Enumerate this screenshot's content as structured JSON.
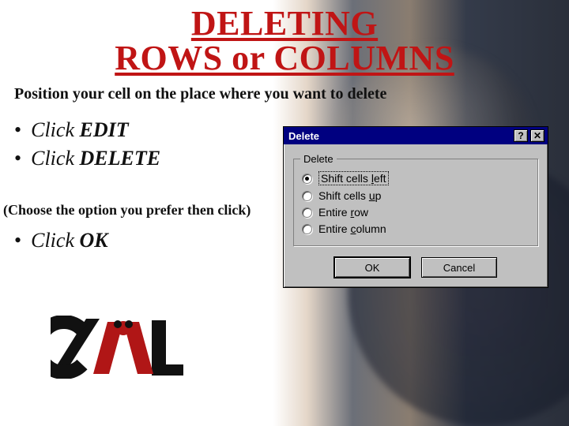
{
  "title_line1": "DELETING",
  "title_line2": "ROWS or COLUMNS",
  "subtitle": "Position your cell on the place where you want to delete",
  "bullet_prefix": "Click",
  "bullets": {
    "edit": "EDIT",
    "delete": "DELETE"
  },
  "choose_note": "(Choose the option you prefer then click)",
  "ok_bullet_kw": "OK",
  "dialog": {
    "title": "Delete",
    "help_glyph": "?",
    "close_glyph": "✕",
    "group_label": "Delete",
    "options": {
      "shift_left": {
        "html": "Shift cells <span class='ul'>l</span>eft",
        "selected": true
      },
      "shift_up": {
        "html": "Shift cells <span class='ul'>u</span>p",
        "selected": false
      },
      "entire_row": {
        "html": "Entire <span class='ul'>r</span>ow",
        "selected": false
      },
      "entire_col": {
        "html": "Entire <span class='ul'>c</span>olumn",
        "selected": false
      }
    },
    "buttons": {
      "ok": "OK",
      "cancel": "Cancel"
    }
  }
}
